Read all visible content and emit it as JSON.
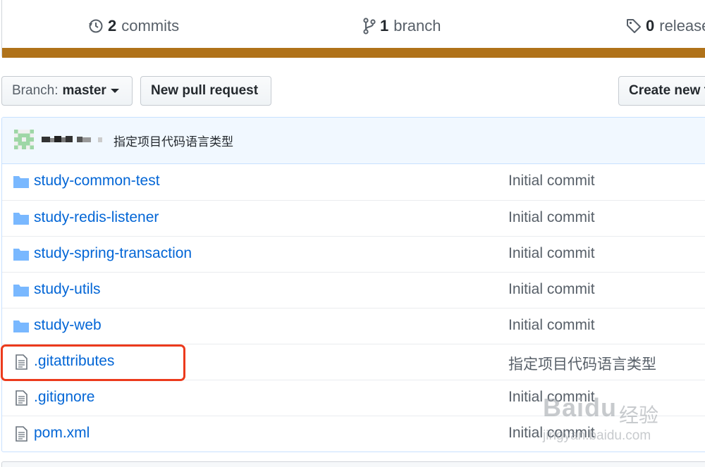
{
  "summary": {
    "commits_count": "2",
    "commits_label": "commits",
    "branches_count": "1",
    "branches_label": "branch",
    "releases_count": "0",
    "releases_label": "releases",
    "language_color": "#b07219"
  },
  "toolbar": {
    "branch_prefix": "Branch:",
    "branch_name": "master",
    "new_pull_request": "New pull request",
    "create_new_file": "Create new file"
  },
  "latest_commit": {
    "message": "指定项目代码语言类型"
  },
  "files": [
    {
      "type": "directory",
      "icon": "folder-icon",
      "name": "study-common-test",
      "message": "Initial commit"
    },
    {
      "type": "directory",
      "icon": "folder-icon",
      "name": "study-redis-listener",
      "message": "Initial commit"
    },
    {
      "type": "directory",
      "icon": "folder-icon",
      "name": "study-spring-transaction",
      "message": "Initial commit"
    },
    {
      "type": "directory",
      "icon": "folder-icon",
      "name": "study-utils",
      "message": "Initial commit"
    },
    {
      "type": "directory",
      "icon": "folder-icon",
      "name": "study-web",
      "message": "Initial commit"
    },
    {
      "type": "file",
      "icon": "file-icon",
      "name": ".gitattributes",
      "message": "指定项目代码语言类型"
    },
    {
      "type": "file",
      "icon": "file-icon",
      "name": ".gitignore",
      "message": "Initial commit"
    },
    {
      "type": "file",
      "icon": "file-icon",
      "name": "pom.xml",
      "message": "Initial commit"
    }
  ],
  "watermark": {
    "logo": "Baidu",
    "text": "经验",
    "url": "jingyan.baidu.com"
  },
  "colors": {
    "link": "#0366d6",
    "highlight": "#ec3a1c",
    "commit_tease_bg": "#f1f8ff"
  }
}
